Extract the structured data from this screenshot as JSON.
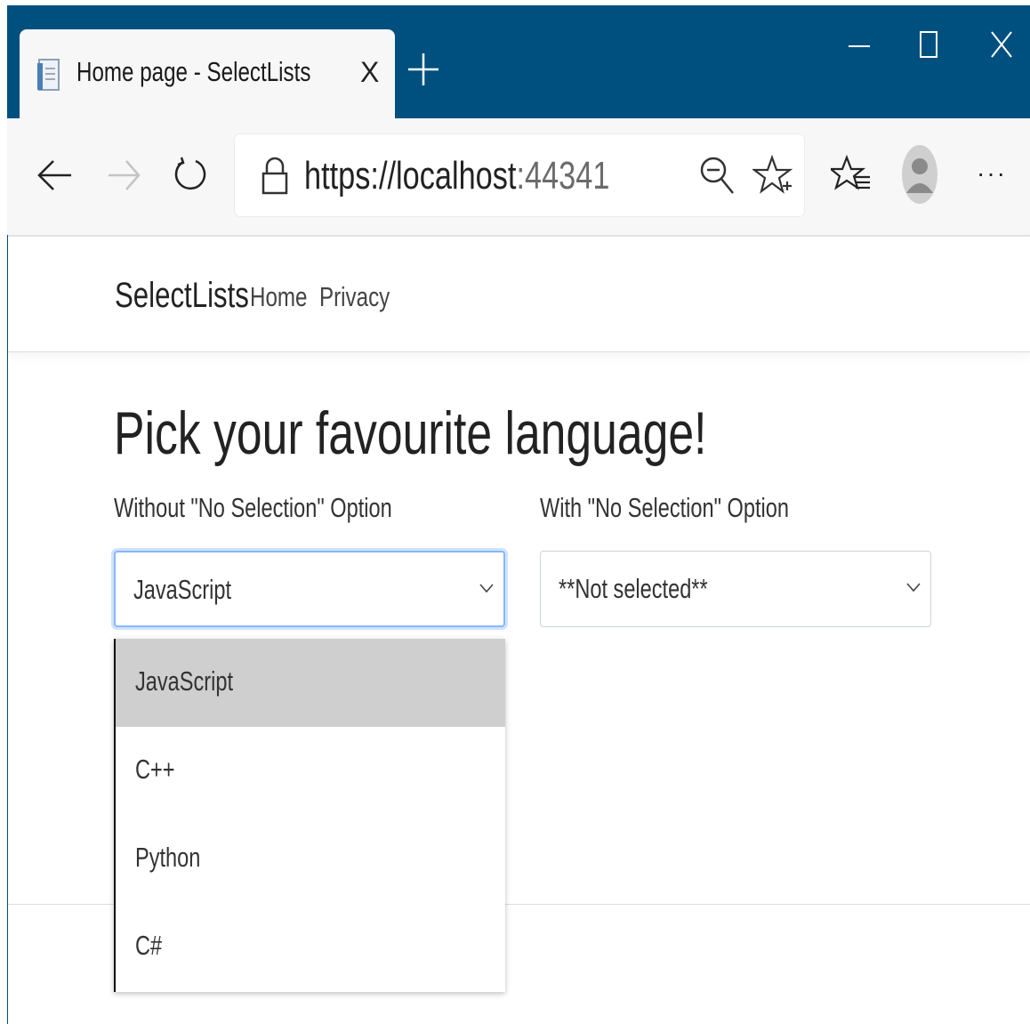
{
  "browser": {
    "tab_title": "Home page - SelectLists",
    "tab_close_label": "X",
    "address": "https://localhost",
    "address_port": ":44341",
    "more_label": "···",
    "icons": [
      "document-icon",
      "plus-icon",
      "minimize-icon",
      "maximize-icon",
      "close-icon",
      "back-arrow-icon",
      "forward-arrow-icon",
      "refresh-icon",
      "lock-icon",
      "zoom-out-icon",
      "add-favorite-icon",
      "favorites-icon",
      "profile-avatar-icon",
      "more-icon"
    ],
    "accent_color": "#00507f"
  },
  "site": {
    "brand": "SelectLists",
    "nav": [
      "Home",
      "Privacy"
    ]
  },
  "main": {
    "heading": "Pick your favourite language!",
    "select_without": {
      "label": "Without \"No Selection\" Option",
      "value": "JavaScript",
      "options": [
        "JavaScript",
        "C++",
        "Python",
        "C#"
      ],
      "highlighted": "JavaScript"
    },
    "select_with": {
      "label": "With \"No Selection\" Option",
      "value": "**Not selected**"
    }
  }
}
